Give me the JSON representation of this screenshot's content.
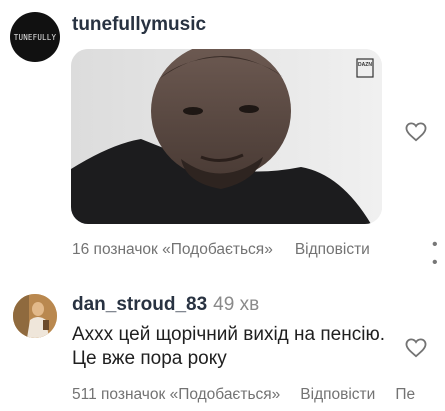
{
  "comments": [
    {
      "username": "tunefullymusic",
      "avatar_text": "TUNEFULLY",
      "media": {
        "watermark": "DAZN"
      },
      "likes_label": "16 позначок «Подобається»",
      "reply_label": "Відповісти",
      "more_label": "• •",
      "like_icon": "heart-outline-icon"
    },
    {
      "username": "dan_stroud_83",
      "time": "49 хв",
      "text": "Аххх цей щорічний вихід на пенсію. Це вже пора року",
      "likes_label": "511 позначок «Подобається»",
      "reply_label": "Відповісти",
      "cut_label": "Пе",
      "like_icon": "heart-outline-icon"
    }
  ],
  "colors": {
    "username": "#283241",
    "meta": "#737373",
    "background": "#ffffff"
  }
}
